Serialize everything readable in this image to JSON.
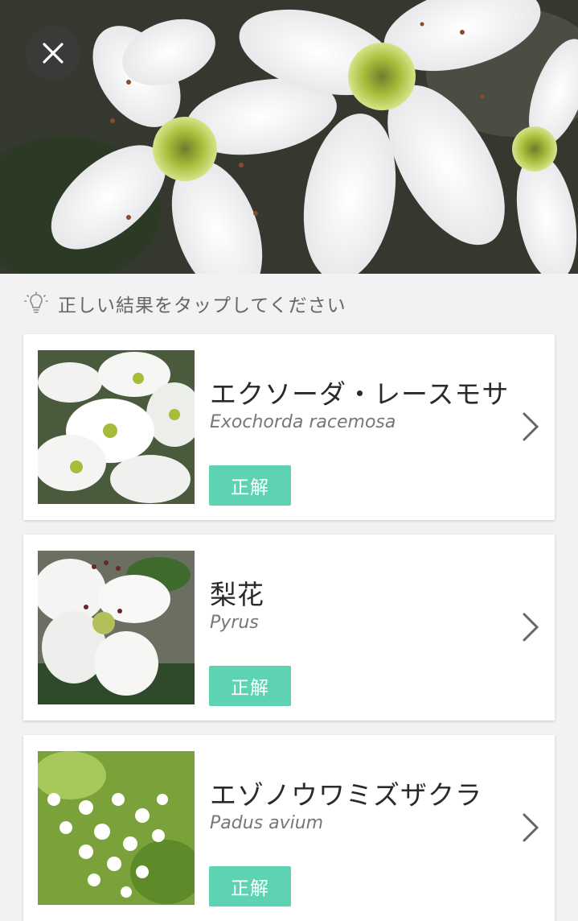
{
  "header": {
    "close_icon": "close-icon"
  },
  "hint": {
    "icon": "lightbulb-icon",
    "text": "正しい結果をタップしてください"
  },
  "results": [
    {
      "name": "エクソーダ・レースモサ",
      "scientific": "Exochorda racemosa",
      "badge": "正解"
    },
    {
      "name": "梨花",
      "scientific": "Pyrus",
      "badge": "正解"
    },
    {
      "name": "エゾノウワミズザクラ",
      "scientific": "Padus avium",
      "badge": "正解"
    }
  ],
  "colors": {
    "accent": "#5dd3b3",
    "background": "#f2f2f2",
    "card": "#ffffff"
  }
}
